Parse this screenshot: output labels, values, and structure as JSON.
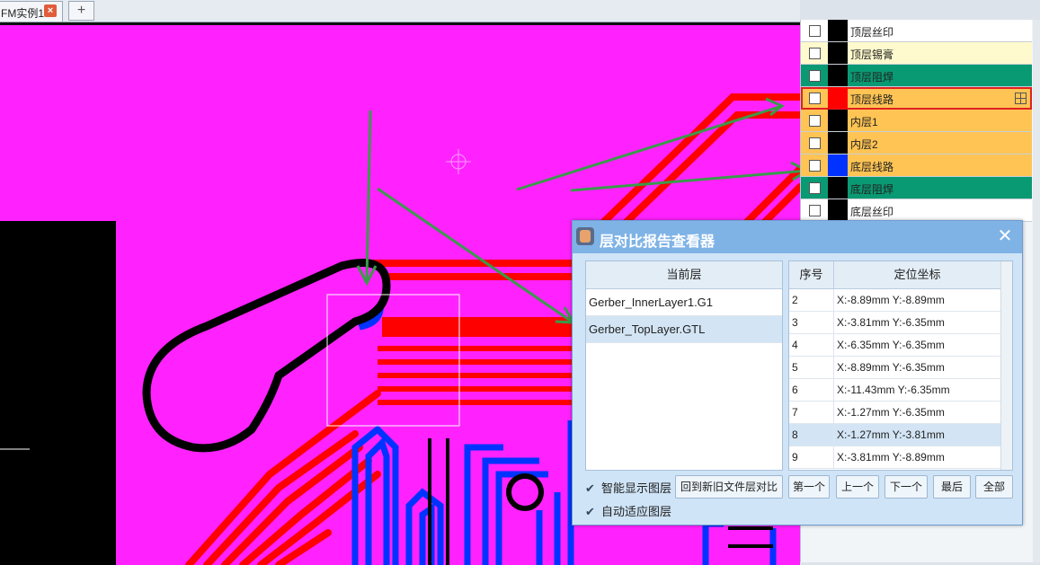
{
  "tab": {
    "title": "FM实例1",
    "close_icon": "×",
    "add_icon": "+"
  },
  "layers": [
    {
      "label": "顶层丝印",
      "swatch": "#000000",
      "bg": "#ffffff"
    },
    {
      "label": "顶层锡膏",
      "swatch": "#000000",
      "bg": "#fffacd"
    },
    {
      "label": "顶层阻焊",
      "swatch": "#000000",
      "bg": "#0a9a73"
    },
    {
      "label": "顶层线路",
      "swatch": "#ff0000",
      "bg": "#ffc454",
      "highlighted": true
    },
    {
      "label": "内层1",
      "swatch": "#000000",
      "bg": "#ffc454"
    },
    {
      "label": "内层2",
      "swatch": "#000000",
      "bg": "#ffc454"
    },
    {
      "label": "底层线路",
      "swatch": "#0033ff",
      "bg": "#ffc454"
    },
    {
      "label": "底层阻焊",
      "swatch": "#000000",
      "bg": "#0a9a73"
    },
    {
      "label": "底层丝印",
      "swatch": "#000000",
      "bg": "#ffffff"
    }
  ],
  "dialog": {
    "title": "层对比报告查看器",
    "close": "✕",
    "left_header": "当前层",
    "files": [
      "Gerber_InnerLayer1.G1",
      "Gerber_TopLayer.GTL"
    ],
    "selected_file_index": 1,
    "col_index": "序号",
    "col_coord": "定位坐标",
    "rows": [
      {
        "idx": "2",
        "coord": "X:-8.89mm Y:-8.89mm"
      },
      {
        "idx": "3",
        "coord": "X:-3.81mm Y:-6.35mm"
      },
      {
        "idx": "4",
        "coord": "X:-6.35mm Y:-6.35mm"
      },
      {
        "idx": "5",
        "coord": "X:-8.89mm Y:-6.35mm"
      },
      {
        "idx": "6",
        "coord": "X:-11.43mm Y:-6.35mm"
      },
      {
        "idx": "7",
        "coord": "X:-1.27mm Y:-6.35mm"
      },
      {
        "idx": "8",
        "coord": "X:-1.27mm Y:-3.81mm"
      },
      {
        "idx": "9",
        "coord": "X:-3.81mm Y:-8.89mm"
      }
    ],
    "selected_row_index": 6,
    "opt_smart": "智能显示图层",
    "opt_auto": "自动适应图层",
    "btn_back": "回到新旧文件层对比",
    "btn_first": "第一个",
    "btn_prev": "上一个",
    "btn_next": "下一个",
    "btn_last": "最后",
    "btn_all": "全部"
  },
  "colors": {
    "board": "#ff22ff",
    "top_trace": "#ff0000",
    "bottom_trace": "#0033ff",
    "annotation_arrow": "#3a9a4a"
  }
}
